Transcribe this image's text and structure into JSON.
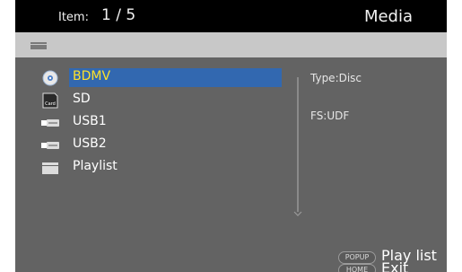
{
  "header": {
    "item_label": "Item:",
    "item_counter": "1 / 5",
    "title": "Media"
  },
  "pathbar": {
    "icon": "folder-icon"
  },
  "list": {
    "items": [
      {
        "label": "BDMV",
        "icon": "disc-icon",
        "selected": true
      },
      {
        "label": "SD",
        "icon": "sd-card-icon",
        "selected": false
      },
      {
        "label": "USB1",
        "icon": "usb-icon",
        "selected": false
      },
      {
        "label": "USB2",
        "icon": "usb-icon",
        "selected": false
      },
      {
        "label": "Playlist",
        "icon": "folder-icon",
        "selected": false
      }
    ]
  },
  "info": {
    "type": "Type:Disc",
    "fs": "FS:UDF"
  },
  "keys": [
    {
      "badge": "POPUP",
      "label": "Play list"
    },
    {
      "badge": "HOME",
      "label": "Exit"
    }
  ],
  "colors": {
    "selection": "#3268b0",
    "selected_text": "#ffe22a",
    "background": "#636363",
    "header": "#000000",
    "pathbar": "#c8c8c8"
  }
}
